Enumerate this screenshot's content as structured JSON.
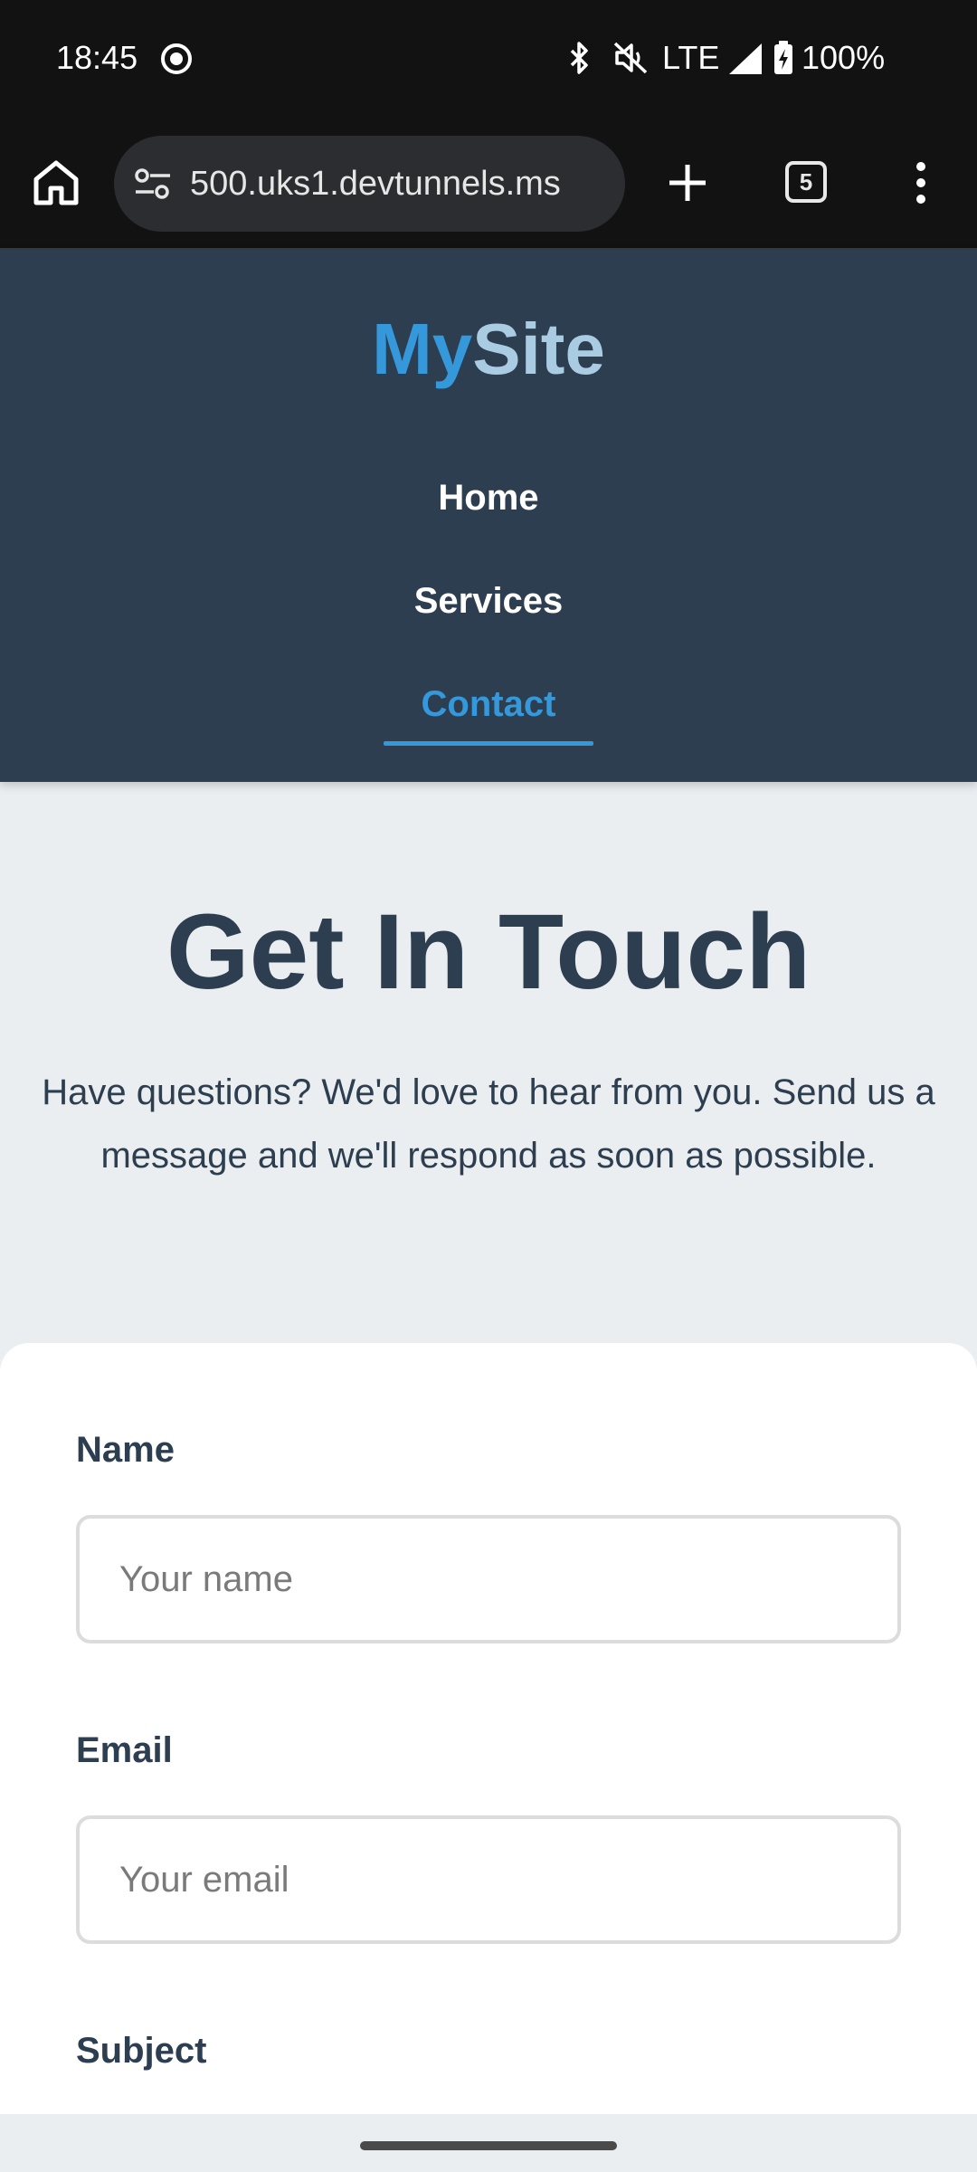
{
  "status_bar": {
    "time": "18:45",
    "network": "LTE",
    "battery": "100%"
  },
  "browser": {
    "url": "500.uks1.devtunnels.ms",
    "tab_count": "5"
  },
  "site": {
    "brand_part1": "My",
    "brand_part2": "Site",
    "nav": {
      "home": "Home",
      "services": "Services",
      "contact": "Contact"
    },
    "colors": {
      "header_bg": "#2c3e50",
      "accent": "#3498db"
    }
  },
  "hero": {
    "title": "Get In Touch",
    "subtitle": "Have questions? We'd love to hear from you. Send us a message and we'll respond as soon as possible."
  },
  "form": {
    "name_label": "Name",
    "name_placeholder": "Your name",
    "email_label": "Email",
    "email_placeholder": "Your email",
    "subject_label": "Subject"
  }
}
